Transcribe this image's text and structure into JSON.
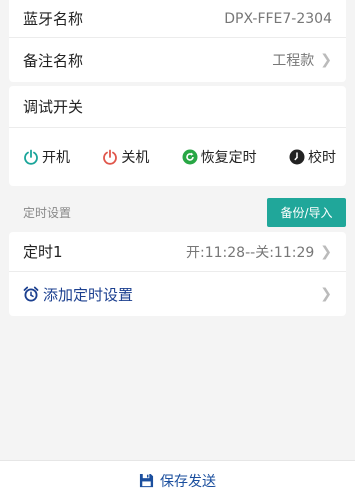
{
  "device": {
    "bluetooth_label": "蓝牙名称",
    "bluetooth_value": "DPX-FFE7-2304",
    "note_label": "备注名称",
    "note_value": "工程款"
  },
  "debug": {
    "title": "调试开关",
    "buttons": [
      {
        "label": "开机",
        "icon": "power-icon",
        "color": "#1aa59a"
      },
      {
        "label": "关机",
        "icon": "power-icon",
        "color": "#e0564b"
      },
      {
        "label": "恢复定时",
        "icon": "refresh-icon",
        "color": "#28a745"
      },
      {
        "label": "校时",
        "icon": "clock-icon",
        "color": "#222222"
      }
    ]
  },
  "timer_section": {
    "title": "定时设置",
    "backup_button": "备份/导入"
  },
  "timers": [
    {
      "name": "定时1",
      "value": "开:11:28--关:11:29"
    }
  ],
  "add_timer": {
    "label": "添加定时设置",
    "icon": "alarm-clock-icon"
  },
  "footer": {
    "save_label": "保存发送",
    "icon": "floppy-disk-icon"
  },
  "colors": {
    "accent": "#20a79a",
    "link": "#1b4f9e"
  }
}
